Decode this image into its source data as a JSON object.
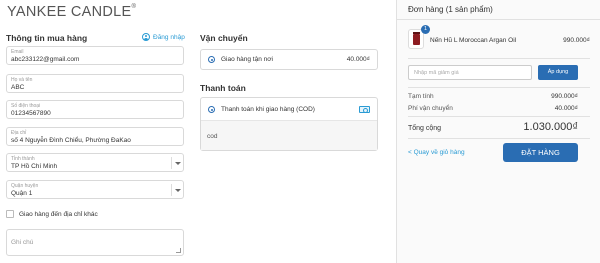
{
  "brand": {
    "logo_text": "YANKEE CANDLE",
    "reg_mark": "®"
  },
  "customer_info": {
    "title": "Thông tin mua hàng",
    "login_link": "Đăng nhập",
    "fields": [
      {
        "label": "Email",
        "value": "abc233122@gmail.com"
      },
      {
        "label": "Họ và tên",
        "value": "ABC"
      },
      {
        "label": "Số điện thoại",
        "value": "01234567890"
      },
      {
        "label": "Địa chỉ",
        "value": "số 4 Nguyễn Đình Chiểu, Phường ĐaKao"
      }
    ],
    "selects": [
      {
        "label": "Tỉnh thành",
        "value": "TP Hồ Chí Minh"
      },
      {
        "label": "Quận huyện",
        "value": "Quận 1"
      }
    ],
    "alt_address_checkbox": "Giao hàng đến địa chỉ khác",
    "note_placeholder": "Ghi chú"
  },
  "shipping": {
    "title": "Vận chuyển",
    "option_label": "Giao hàng tận nơi",
    "option_price": "40.000₫"
  },
  "payment": {
    "title": "Thanh toán",
    "option_label": "Thanh toán khi giao hàng (COD)",
    "option_detail": "cod"
  },
  "order": {
    "header": "Đơn hàng (1 sản phẩm)",
    "item": {
      "quantity": "1",
      "name": "Nến Hũ L Moroccan Argan Oil",
      "price": "990.000₫"
    },
    "discount_placeholder": "Nhập mã giảm giá",
    "apply_button": "Áp dụng",
    "subtotal_label": "Tạm tính",
    "subtotal_value": "990.000₫",
    "shipping_label": "Phí vận chuyển",
    "shipping_value": "40.000₫",
    "total_label": "Tổng cộng",
    "total_value": "1.030.000₫",
    "back_link": "< Quay về giỏ hàng",
    "place_order_button": "ĐẶT HÀNG"
  },
  "colors": {
    "accent": "#2a6db3",
    "link": "#2a9bd4"
  }
}
